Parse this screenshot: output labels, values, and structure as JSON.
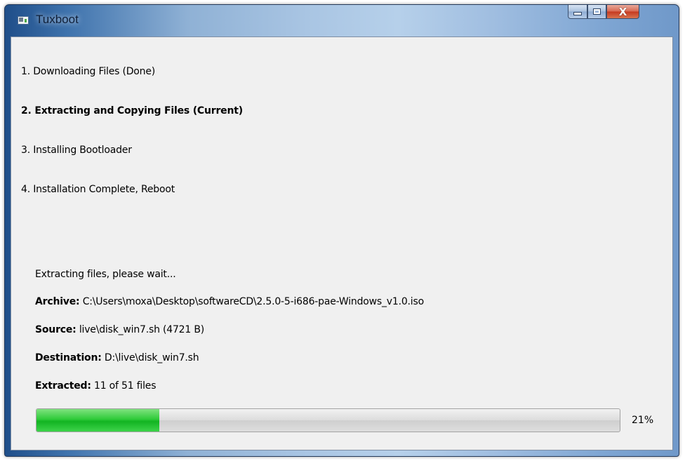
{
  "window": {
    "title": "Tuxboot",
    "close_label": "X"
  },
  "steps": [
    {
      "label": "1. Downloading Files (Done)",
      "current": false
    },
    {
      "label": "2. Extracting and Copying Files (Current)",
      "current": true
    },
    {
      "label": "3. Installing Bootloader",
      "current": false
    },
    {
      "label": "4. Installation Complete, Reboot",
      "current": false
    }
  ],
  "details": {
    "status": "Extracting files, please wait...",
    "archive_label": "Archive:",
    "archive_value": "C:\\Users\\moxa\\Desktop\\softwareCD\\2.5.0-5-i686-pae-Windows_v1.0.iso",
    "source_label": "Source:",
    "source_value": "live\\disk_win7.sh (4721 B)",
    "destination_label": "Destination:",
    "destination_value": "D:\\live\\disk_win7.sh",
    "extracted_label": "Extracted:",
    "extracted_value": "11 of 51 files"
  },
  "progress": {
    "percent": 21,
    "label": "21%",
    "fill_color": "#1ec82e"
  },
  "icons": {
    "app": "app-window-icon",
    "minimize": "minimize-icon",
    "maximize": "maximize-icon",
    "close": "close-icon"
  }
}
